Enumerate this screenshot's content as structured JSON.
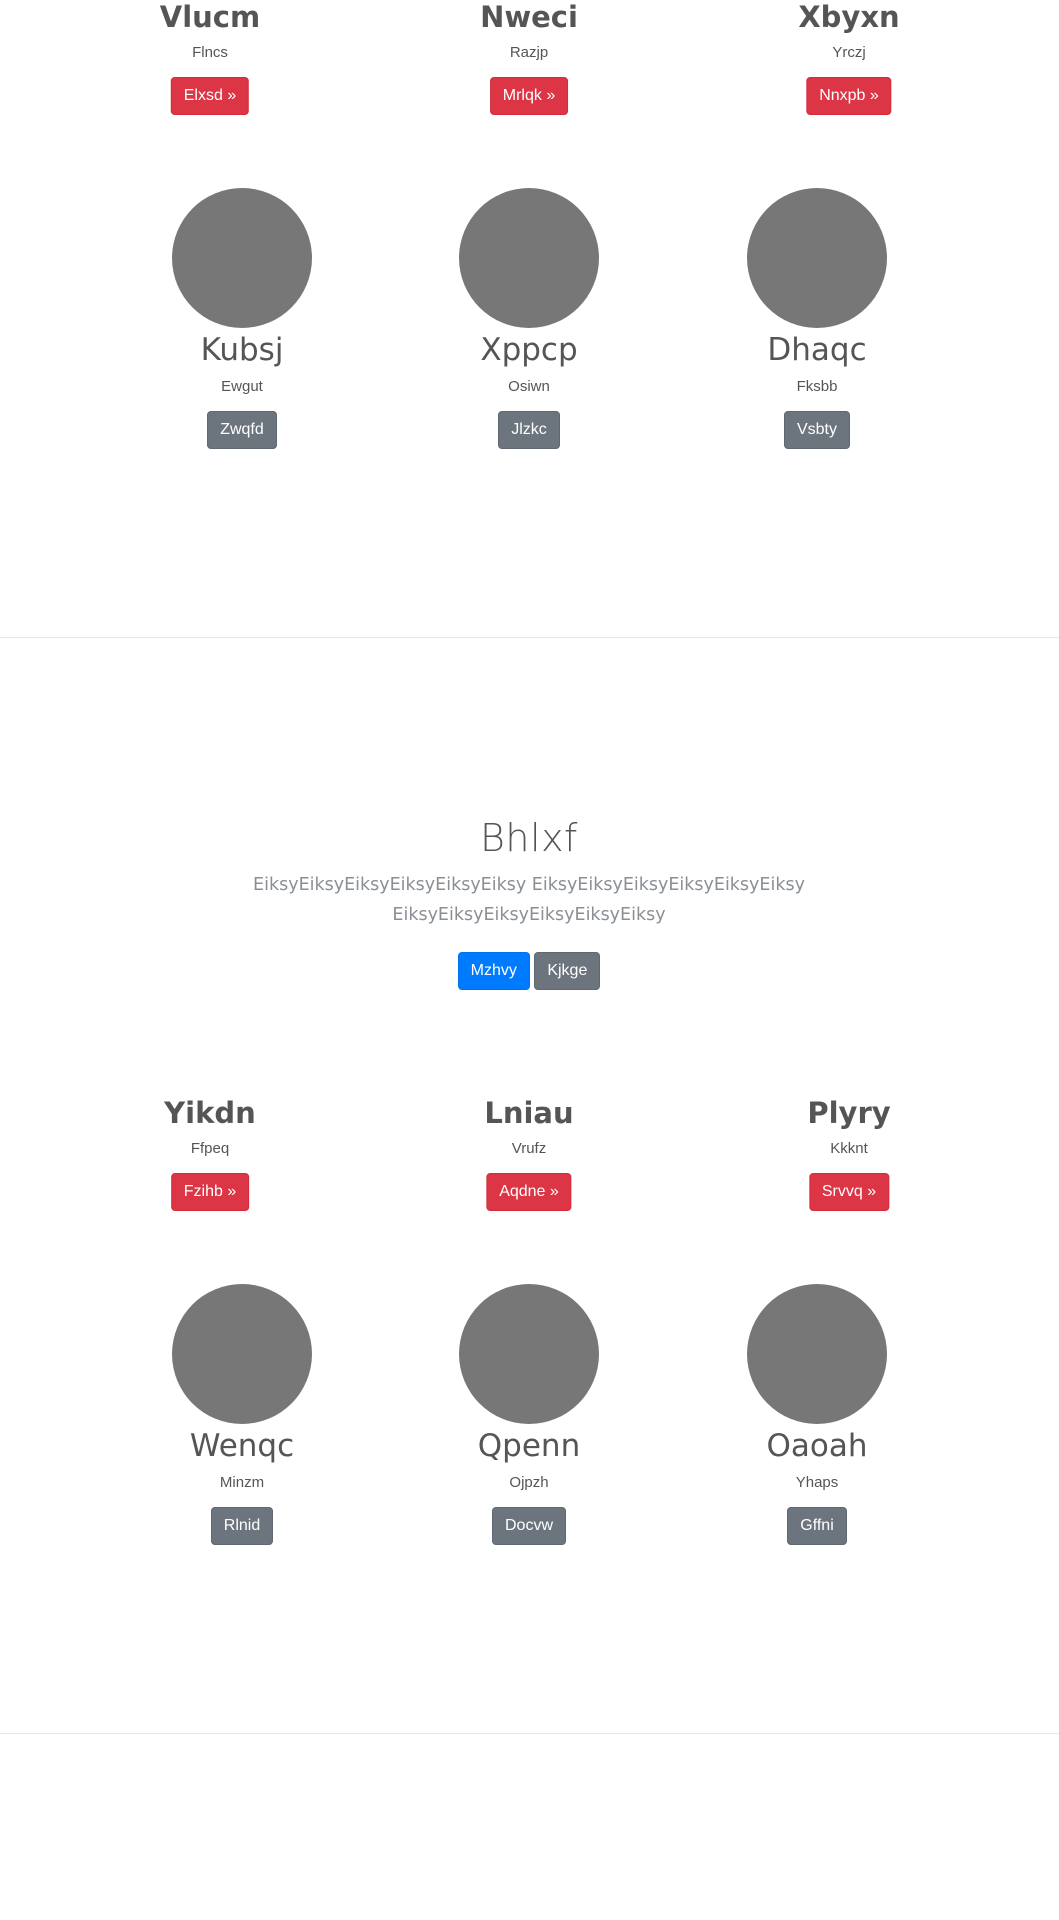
{
  "section1": {
    "features": [
      {
        "title": "Vlucm",
        "subtitle": "Flncs",
        "button": "Elxsd »"
      },
      {
        "title": "Nweci",
        "subtitle": "Razjp",
        "button": "Mrlqk »"
      },
      {
        "title": "Xbyxn",
        "subtitle": "Yrczj",
        "button": "Nnxpb »"
      }
    ],
    "team": [
      {
        "name": "Kubsj",
        "subtitle": "Ewgut",
        "button": "Zwqfd"
      },
      {
        "name": "Xppcp",
        "subtitle": "Osiwn",
        "button": "Jlzkc"
      },
      {
        "name": "Dhaqc",
        "subtitle": "Fksbb",
        "button": "Vsbty"
      }
    ]
  },
  "hero": {
    "title": "Bhlxf",
    "text": "EiksyEiksyEiksyEiksyEiksyEiksy EiksyEiksyEiksyEiksyEiksyEiksy EiksyEiksyEiksyEiksyEiksyEiksy",
    "primary_button": "Mzhvy",
    "secondary_button": "Kjkge"
  },
  "section2": {
    "features": [
      {
        "title": "Yikdn",
        "subtitle": "Ffpeq",
        "button": "Fzihb »"
      },
      {
        "title": "Lniau",
        "subtitle": "Vrufz",
        "button": "Aqdne »"
      },
      {
        "title": "Plyry",
        "subtitle": "Kkknt",
        "button": "Srvvq »"
      }
    ],
    "team": [
      {
        "name": "Wenqc",
        "subtitle": "Minzm",
        "button": "Rlnid"
      },
      {
        "name": "Qpenn",
        "subtitle": "Ojpzh",
        "button": "Docvw"
      },
      {
        "name": "Oaoah",
        "subtitle": "Yhaps",
        "button": "Gffni"
      }
    ]
  },
  "colors": {
    "danger": "#dc3545",
    "secondary": "#6c757d",
    "primary": "#007bff",
    "placeholder": "#777777"
  }
}
